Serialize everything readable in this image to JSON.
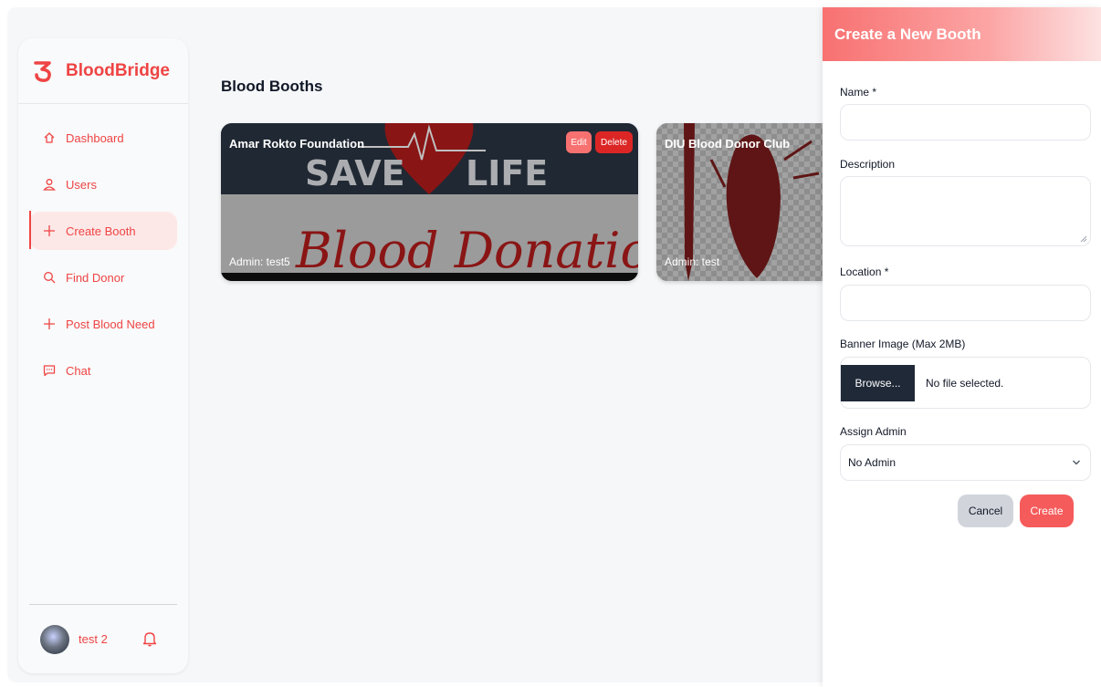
{
  "app": {
    "name": "BloodBridge",
    "brand_color": "#ef4444"
  },
  "sidebar": {
    "items": [
      {
        "label": "Dashboard",
        "icon": "home-icon",
        "active": false
      },
      {
        "label": "Users",
        "icon": "users-icon",
        "active": false
      },
      {
        "label": "Create Booth",
        "icon": "plus-icon",
        "active": true
      },
      {
        "label": "Find Donor",
        "icon": "search-icon",
        "active": false
      },
      {
        "label": "Post Blood Need",
        "icon": "plus-icon",
        "active": false
      },
      {
        "label": "Chat",
        "icon": "chat-icon",
        "active": false
      }
    ],
    "user": {
      "name": "test 2"
    }
  },
  "main": {
    "title": "Blood Booths",
    "booths": [
      {
        "name": "Amar Rokto Foundation",
        "admin": "Admin: test5",
        "edit_label": "Edit",
        "delete_label": "Delete"
      },
      {
        "name": "DIU Blood Donor Club",
        "admin": "Admin: test"
      }
    ]
  },
  "banner": {
    "line1_left": "SAVE",
    "line1_right": "LIFE",
    "line2": "Blood Donation"
  },
  "panel": {
    "title": "Create a New Booth",
    "name_label": "Name *",
    "name_value": "",
    "description_label": "Description",
    "description_value": "",
    "location_label": "Location *",
    "location_value": "",
    "banner_label": "Banner Image (Max 2MB)",
    "browse_label": "Browse...",
    "file_status": "No file selected.",
    "admin_label": "Assign Admin",
    "admin_value": "No Admin",
    "cancel_label": "Cancel",
    "create_label": "Create"
  }
}
